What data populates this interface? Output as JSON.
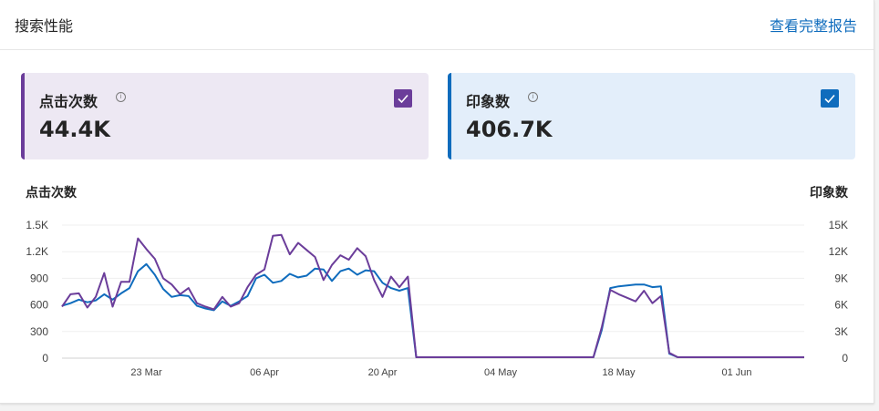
{
  "header": {
    "title": "搜索性能",
    "report_link": "查看完整报告"
  },
  "tiles": [
    {
      "label": "点击次数",
      "value": "44.4K",
      "checked": true,
      "color": "#6b3d9a"
    },
    {
      "label": "印象数",
      "value": "406.7K",
      "checked": true,
      "color": "#0f6cbd"
    }
  ],
  "colors": {
    "clicks": "#6b3d9a",
    "impressions": "#0f6cbd",
    "link": "#0f6cbd"
  },
  "icons": {
    "info": "info-icon",
    "check": "check-icon"
  },
  "chart_data": {
    "type": "line",
    "ylabel_left": "点击次数",
    "ylabel_right": "印象数",
    "y_ticks_left": [
      "0",
      "300",
      "600",
      "900",
      "1.2K",
      "1.5K"
    ],
    "y_ticks_right": [
      "0",
      "3K",
      "6K",
      "9K",
      "12K",
      "15K"
    ],
    "ylim_left": [
      0,
      1500
    ],
    "ylim_right": [
      0,
      15000
    ],
    "x_ticks": [
      "23 Mar",
      "06 Apr",
      "20 Apr",
      "04 May",
      "18 May",
      "01 Jun"
    ],
    "x_tick_days": [
      10,
      24,
      38,
      52,
      66,
      80
    ],
    "day_count": 89,
    "grid": true,
    "series": [
      {
        "name": "点击次数",
        "axis": "left",
        "values": [
          580,
          720,
          730,
          570,
          690,
          960,
          580,
          860,
          860,
          1350,
          1230,
          1120,
          900,
          830,
          720,
          790,
          620,
          580,
          550,
          690,
          580,
          620,
          800,
          940,
          1000,
          1380,
          1390,
          1170,
          1300,
          1220,
          1140,
          880,
          1050,
          1160,
          1110,
          1240,
          1150,
          880,
          690,
          920,
          800,
          920,
          10,
          10,
          10,
          10,
          10,
          10,
          10,
          10,
          10,
          10,
          10,
          10,
          10,
          10,
          10,
          10,
          10,
          10,
          10,
          10,
          10,
          10,
          350,
          770,
          720,
          680,
          640,
          760,
          620,
          700,
          60,
          10,
          10,
          10,
          10,
          10,
          10,
          10,
          10,
          10,
          10,
          10,
          10,
          10,
          10,
          10,
          10
        ]
      },
      {
        "name": "印象数",
        "axis": "right",
        "values": [
          5900,
          6200,
          6600,
          6300,
          6500,
          7200,
          6600,
          7300,
          7900,
          9800,
          10600,
          9400,
          7800,
          6900,
          7100,
          7000,
          5900,
          5600,
          5400,
          6400,
          5900,
          6400,
          7000,
          9000,
          9400,
          8500,
          8700,
          9500,
          9100,
          9300,
          10100,
          10000,
          8700,
          9800,
          10100,
          9400,
          9900,
          9800,
          8500,
          7900,
          7600,
          7900,
          100,
          100,
          100,
          100,
          100,
          100,
          100,
          100,
          100,
          100,
          100,
          100,
          100,
          100,
          100,
          100,
          100,
          100,
          100,
          100,
          100,
          100,
          3200,
          7900,
          8100,
          8200,
          8300,
          8300,
          8000,
          8100,
          500,
          100,
          100,
          100,
          100,
          100,
          100,
          100,
          100,
          100,
          100,
          100,
          100,
          100,
          100,
          100,
          100
        ]
      }
    ]
  }
}
